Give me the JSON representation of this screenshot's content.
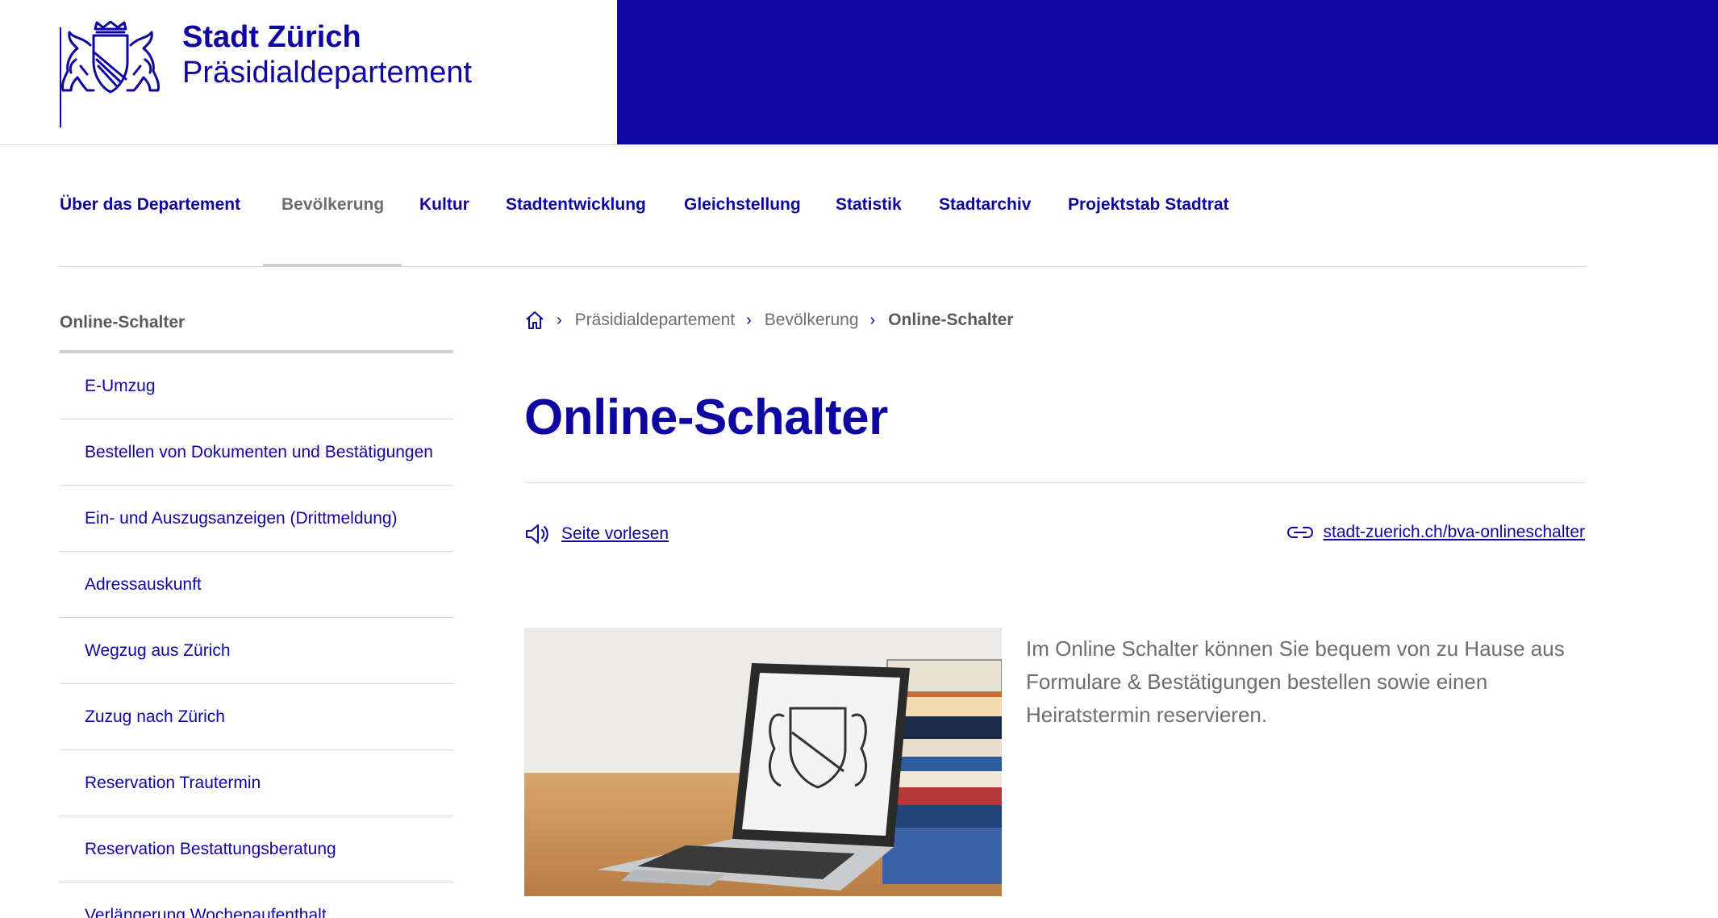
{
  "header": {
    "org_title": "Stadt Zürich",
    "org_subtitle": "Präsidialdepartement",
    "brand_color": "#0f05a0"
  },
  "nav": {
    "items": [
      {
        "label": "Über das Departement",
        "active": false
      },
      {
        "label": "Bevölkerung",
        "active": true
      },
      {
        "label": "Kultur",
        "active": false
      },
      {
        "label": "Stadtentwicklung",
        "active": false
      },
      {
        "label": "Gleichstellung",
        "active": false
      },
      {
        "label": "Statistik",
        "active": false
      },
      {
        "label": "Stadtarchiv",
        "active": false
      },
      {
        "label": "Projektstab Stadtrat",
        "active": false
      }
    ]
  },
  "sidebar": {
    "heading": "Online-Schalter",
    "items": [
      {
        "label": "E-Umzug"
      },
      {
        "label": "Bestellen von Dokumenten und Bestätigungen"
      },
      {
        "label": "Ein- und Auszugsanzeigen (Drittmeldung)"
      },
      {
        "label": "Adressauskunft"
      },
      {
        "label": "Wegzug aus Zürich"
      },
      {
        "label": "Zuzug nach Zürich"
      },
      {
        "label": "Reservation Trautermin"
      },
      {
        "label": "Reservation Bestattungsberatung"
      },
      {
        "label": "Verlängerung Wochenaufenthalt"
      }
    ]
  },
  "breadcrumb": {
    "home_icon": "home-icon",
    "items": [
      "Präsidialdepartement",
      "Bevölkerung"
    ],
    "current": "Online-Schalter"
  },
  "main": {
    "title": "Online-Schalter",
    "read_aloud_label": "Seite vorlesen",
    "short_link": "stadt-zuerich.ch/bva-onlineschalter",
    "intro_text": "Im Online Schalter können Sie bequem von zu Hause aus Formulare & Bestätigungen bestellen sowie einen Heiratstermin reservieren."
  }
}
